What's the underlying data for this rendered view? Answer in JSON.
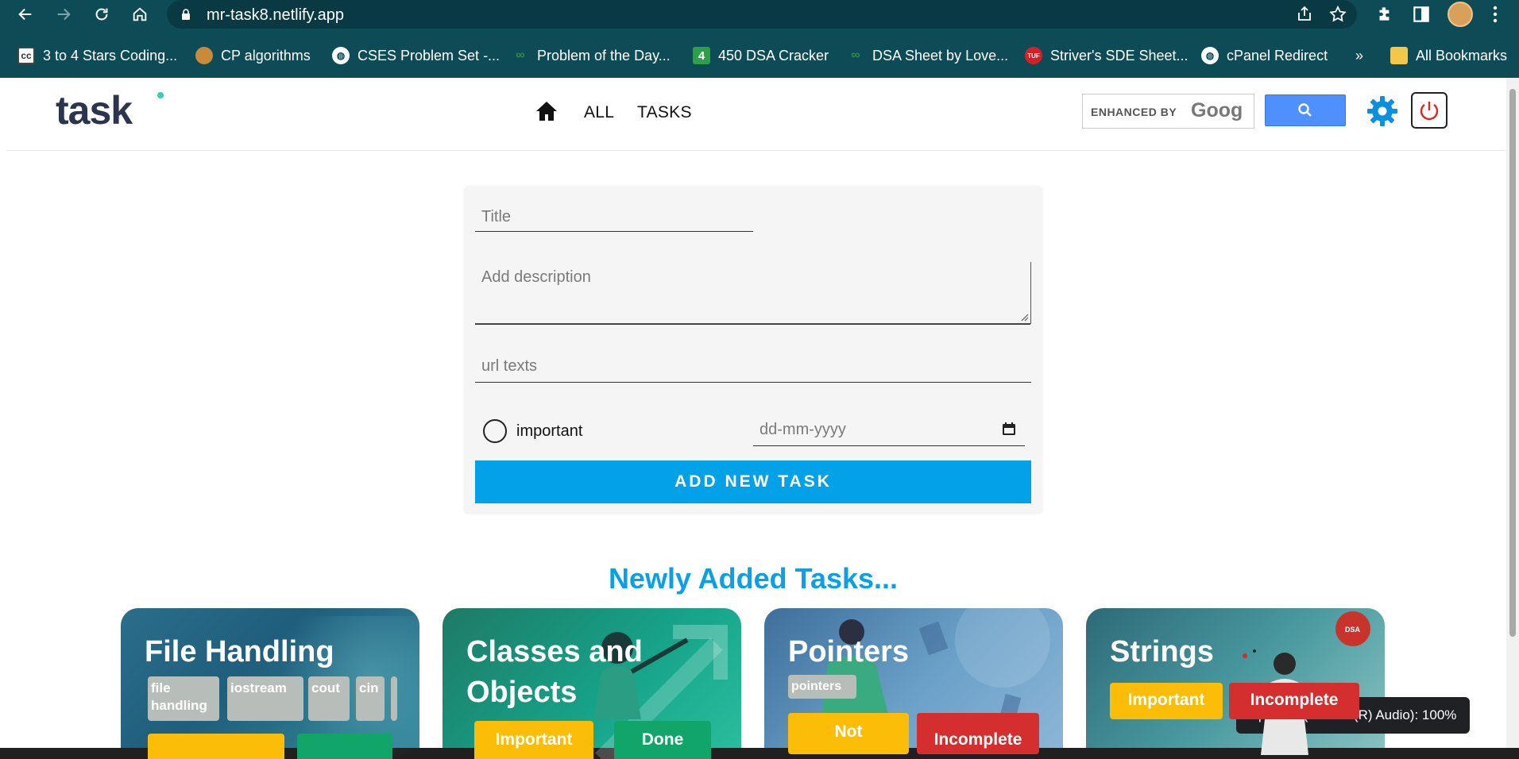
{
  "browser": {
    "url": "mr-task8.netlify.app",
    "bookmarks": [
      {
        "label": "3 to 4 Stars Coding...",
        "icon": "cc-icon"
      },
      {
        "label": "CP algorithms",
        "icon": "cp-algorithms-icon"
      },
      {
        "label": "CSES Problem Set -...",
        "icon": "globe-icon"
      },
      {
        "label": "Problem of the Day...",
        "icon": "gfg-icon"
      },
      {
        "label": "450 DSA Cracker",
        "icon": "four-icon"
      },
      {
        "label": "DSA Sheet by Love...",
        "icon": "gfg-icon"
      },
      {
        "label": "Striver's SDE Sheet...",
        "icon": "tuf-icon"
      },
      {
        "label": "cPanel Redirect",
        "icon": "globe-icon"
      }
    ],
    "overflow": "»",
    "all_bookmarks": "All Bookmarks"
  },
  "header": {
    "logo_text": "task",
    "nav": {
      "all": "ALL",
      "tasks": "TASKS"
    },
    "search": {
      "enhanced_by": "ENHANCED BY",
      "google": "Goog"
    }
  },
  "form": {
    "title_placeholder": "Title",
    "description_placeholder": "Add description",
    "url_placeholder": "url texts",
    "important_label": "important",
    "date_placeholder": "dd-mm-yyyy",
    "submit_label": "ADD NEW TASK"
  },
  "section_title": "Newly Added Tasks...",
  "cards": [
    {
      "title": "File Handling",
      "tags": [
        "file\nhandling",
        "iostream",
        "cout",
        "cin"
      ],
      "badges": []
    },
    {
      "title": "Classes and\nObjects",
      "tags": [],
      "badges": [
        "Important",
        "Done"
      ]
    },
    {
      "title": "Pointers",
      "tags": [
        "pointers"
      ],
      "badges": [
        "Not",
        "Incomplete"
      ]
    },
    {
      "title": "Strings",
      "tags": [],
      "badges": [
        "Important",
        "Incomplete"
      ]
    }
  ],
  "tooltip": "Speaker (Realtek(R) Audio): 100%",
  "colors": {
    "chrome": "#0d4c57",
    "accent": "#03a2e8",
    "important": "#fbbd08",
    "done": "#11a56a",
    "incomplete": "#d42e2e"
  }
}
